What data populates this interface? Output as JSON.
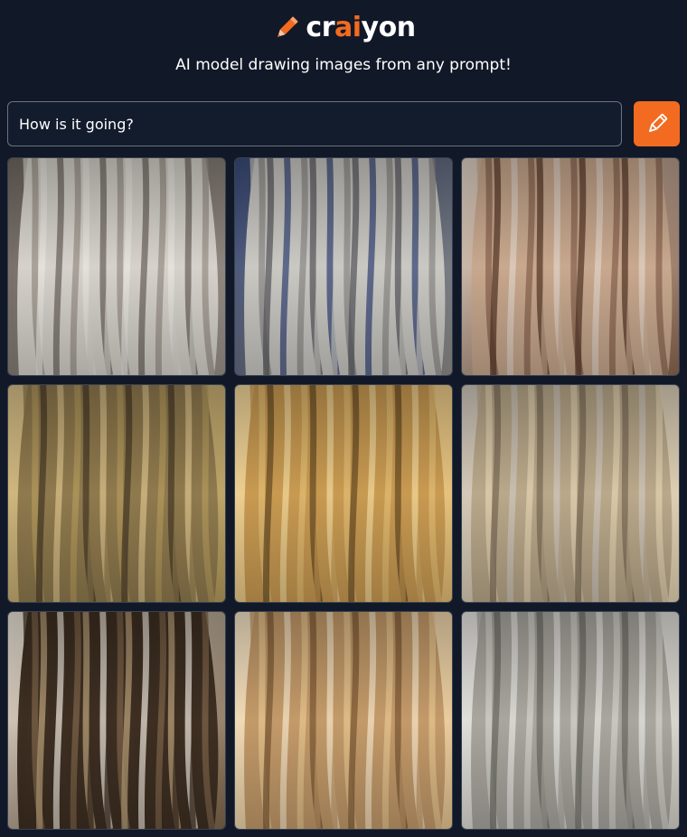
{
  "header": {
    "logo_parts": [
      "cr",
      "ai",
      "yon"
    ],
    "tagline": "AI model drawing images from any prompt!"
  },
  "search": {
    "value": "How is it going?",
    "button_icon": "pencil-icon"
  },
  "colors": {
    "background": "#111827",
    "accent": "#f26b21",
    "input_background": "#131c2c",
    "input_border": "#6b7280"
  },
  "results": [
    {
      "subject": "hair-image",
      "palette": [
        "#d6d2cb",
        "#9a928a",
        "#e8e4df",
        "#6f6760"
      ]
    },
    {
      "subject": "hair-image",
      "palette": [
        "#c9c8c3",
        "#8d8c88",
        "#5b5c61",
        "#3a4a78"
      ]
    },
    {
      "subject": "hair-image",
      "palette": [
        "#c8a88e",
        "#8a6550",
        "#5a3b2a",
        "#e0d2c4"
      ]
    },
    {
      "subject": "hair-image",
      "palette": [
        "#8f7a4e",
        "#b39a5c",
        "#4a3c28",
        "#d8c089"
      ]
    },
    {
      "subject": "hair-image",
      "palette": [
        "#c89a52",
        "#e2bb73",
        "#6b4d26",
        "#f0d59a"
      ]
    },
    {
      "subject": "hair-image",
      "palette": [
        "#b9a88a",
        "#e3d2b0",
        "#7d6e58",
        "#cfc6bb"
      ]
    },
    {
      "subject": "hair-image",
      "palette": [
        "#3e2f22",
        "#7d6449",
        "#b9a079",
        "#e9e2d6"
      ]
    },
    {
      "subject": "hair-image",
      "palette": [
        "#c39a6a",
        "#e6c48f",
        "#7e5a36",
        "#f4e2c4"
      ]
    },
    {
      "subject": "hair-image",
      "palette": [
        "#a9a69f",
        "#d3d0c8",
        "#6f6c66",
        "#e6e4e0"
      ]
    }
  ]
}
